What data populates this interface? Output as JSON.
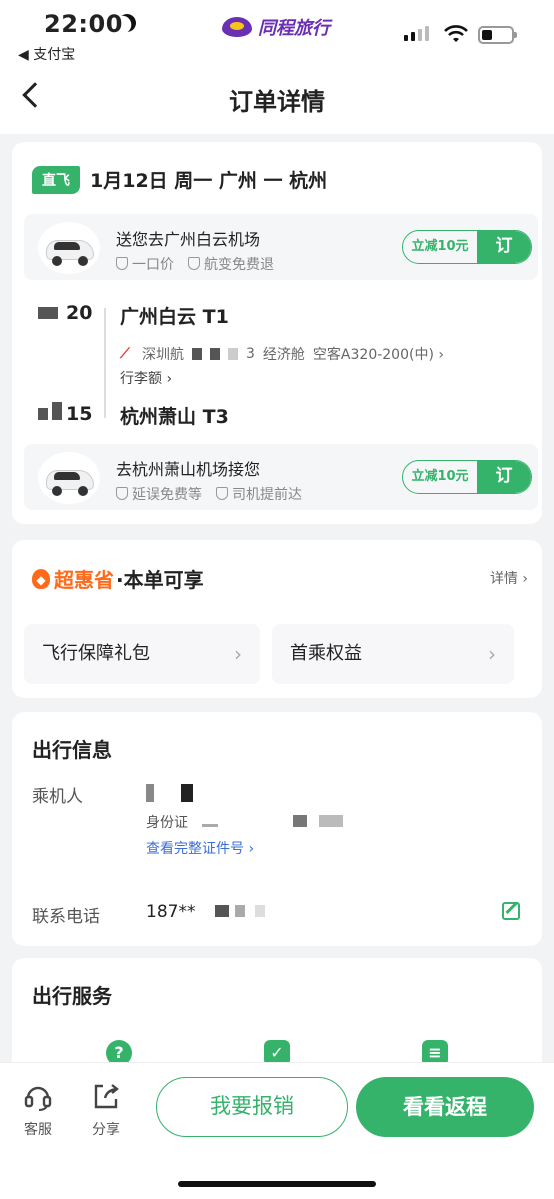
{
  "status_bar": {
    "time": "22:00",
    "back_app": "◀ 支付宝",
    "brand": "同程旅行"
  },
  "nav": {
    "title": "订单详情"
  },
  "flight": {
    "tag": "直飞",
    "route": "1月12日 周一 广州 一 杭州",
    "pickup": {
      "title": "送您去广州白云机场",
      "feat1": "一口价",
      "feat2": "航变免费退",
      "discount": "立减10元",
      "button": "订"
    },
    "dep_time": "20",
    "dep_airport": "广州白云 T1",
    "airline": "深圳航",
    "flight_tail": "3",
    "cabin": "经济舱",
    "aircraft": "空客A320-200(中) ›",
    "luggage": "行李额 ›",
    "arr_time": "15",
    "arr_airport": "杭州萧山 T3",
    "dropoff": {
      "title": "去杭州萧山机场接您",
      "feat1": "延误免费等",
      "feat2": "司机提前达",
      "discount": "立减10元",
      "button": "订"
    }
  },
  "benefits": {
    "brand": "超惠省",
    "subtitle": "·本单可享",
    "detail": "详情 ›",
    "item1": "飞行保障礼包",
    "item2": "首乘权益"
  },
  "travel_info": {
    "title": "出行信息",
    "passenger_label": "乘机人",
    "id_label": "身份证",
    "view_id": "查看完整证件号 ›",
    "phone_label": "联系电话",
    "phone": "187**"
  },
  "service": {
    "title": "出行服务"
  },
  "bottom": {
    "service_label": "客服",
    "share_label": "分享",
    "claim_button": "我要报销",
    "return_button": "看看返程"
  },
  "colors": {
    "accent": "#35b36b",
    "brand": "#6b2fb3",
    "promo_orange": "#ff6a1a"
  }
}
